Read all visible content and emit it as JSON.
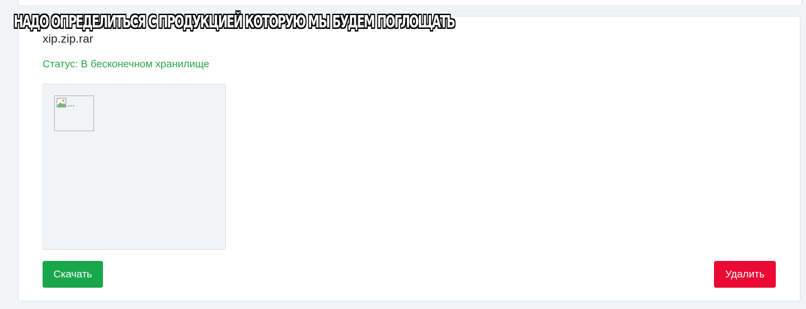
{
  "caption": "Надо определиться с продукцией которую мы будем поглощать",
  "file": {
    "name": "xip.zip.rar",
    "status": "Статус: В бесконечном хранилище",
    "preview_alt": "..."
  },
  "actions": {
    "download_label": "Скачать",
    "delete_label": "Удалить"
  },
  "colors": {
    "status": "#28a745",
    "download": "#1aa64a",
    "delete": "#ea0a33",
    "background": "#f1f4f7"
  },
  "icons": {
    "preview": "broken-image-icon"
  }
}
